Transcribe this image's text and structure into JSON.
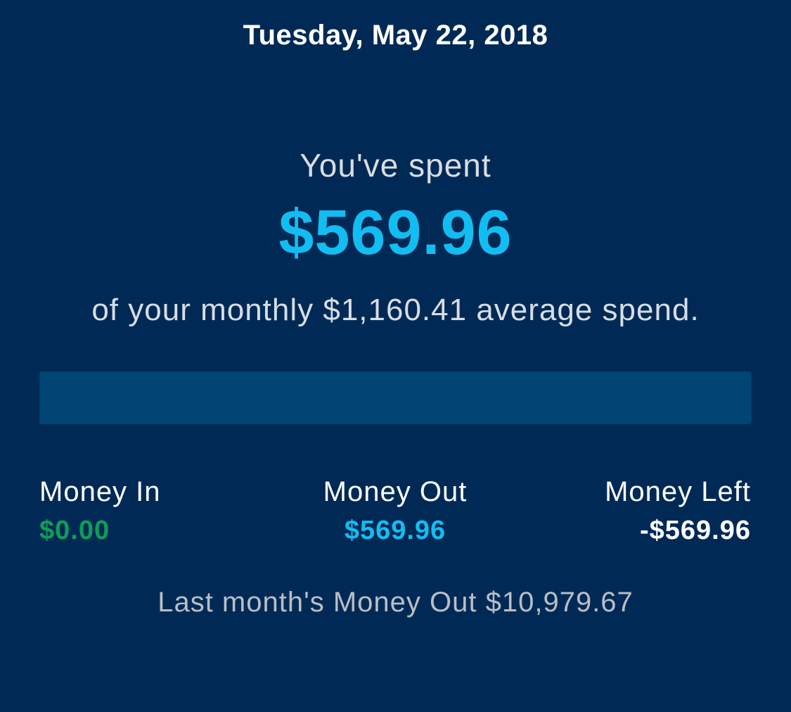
{
  "header": {
    "date": "Tuesday, May 22, 2018"
  },
  "spending": {
    "label": "You've spent",
    "amount": "$569.96",
    "average_line": "of your monthly $1,160.41 average spend.",
    "progress_fraction": 0.0
  },
  "summary": {
    "money_in": {
      "label": "Money In",
      "value": "$0.00"
    },
    "money_out": {
      "label": "Money Out",
      "value": "$569.96"
    },
    "money_left": {
      "label": "Money Left",
      "value": "-$569.96"
    }
  },
  "last_month": {
    "text": "Last month's Money Out $10,979.67"
  },
  "colors": {
    "background": "#002a55",
    "accent": "#12bdf2",
    "positive": "#0f9d58",
    "progress_track": "#004573",
    "text_primary": "#ffffff",
    "text_secondary": "#d8dde4",
    "text_muted": "#b9bec6"
  }
}
